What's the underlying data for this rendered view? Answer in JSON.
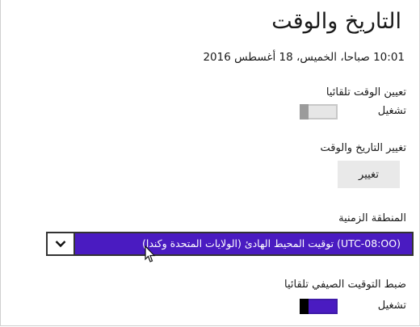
{
  "page": {
    "title": "التاريخ والوقت",
    "current_datetime": "10:01 صباحا، الخميس، 18 أغسطس 2016"
  },
  "auto_time": {
    "label": "تعيين الوقت تلقائيا",
    "state_text": "تشغيل",
    "on": false
  },
  "change_datetime": {
    "label": "تغيير التاريخ والوقت",
    "button_label": "تغيير"
  },
  "time_zone": {
    "label": "المنطقة الزمنية",
    "selected": "(UTC-08:OO) توقيت المحيط الهادئ (الولايات المتحدة وكندا)"
  },
  "dst": {
    "label": "ضبط التوقيت الصيفي تلقائيا",
    "state_text": "تشغيل",
    "on": true
  },
  "colors": {
    "accent": "#4a1bc1",
    "toggle_off_bg": "#e6e6e6",
    "button_bg": "#e9e9e9"
  },
  "icons": {
    "dropdown": "chevron-down-icon",
    "cursor": "mouse-pointer-icon"
  }
}
